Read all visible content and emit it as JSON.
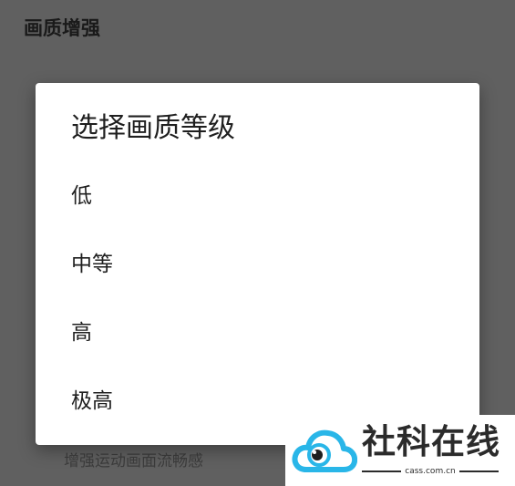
{
  "page": {
    "title": "画质增强",
    "subtitle": "增强运动画面流畅感"
  },
  "dialog": {
    "title": "选择画质等级",
    "options": [
      {
        "label": "低"
      },
      {
        "label": "中等"
      },
      {
        "label": "高"
      },
      {
        "label": "极高"
      }
    ]
  },
  "watermark": {
    "brand": "社科在线",
    "domain": "cass.com.cn",
    "icon": "cloud-eye-logo",
    "colors": {
      "cloud": "#29b6e8",
      "text": "#2b2b2b"
    }
  },
  "colors": {
    "scrim": "#606060",
    "dialog_bg": "#ffffff"
  }
}
